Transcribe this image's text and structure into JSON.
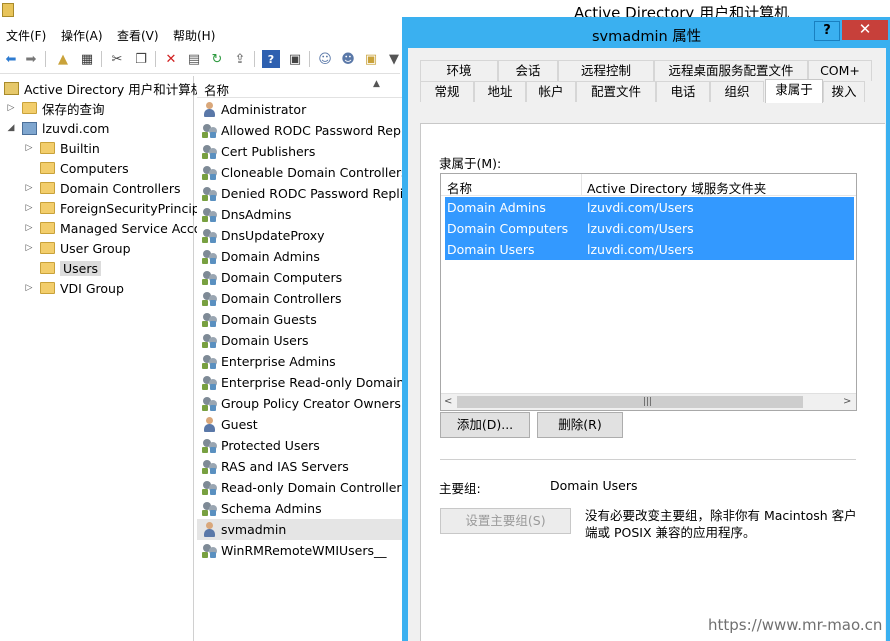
{
  "main_window": {
    "title": "Active Directory 用户和计算机",
    "menu": [
      "文件(F)",
      "操作(A)",
      "查看(V)",
      "帮助(H)"
    ],
    "toolbar_icons": [
      "back-icon",
      "forward-icon",
      "up-folder-icon",
      "show-tree-icon",
      "cut-icon",
      "copy-icon",
      "delete-icon",
      "properties-icon",
      "refresh-icon",
      "export-icon",
      "help-icon",
      "console-icon",
      "new-user-icon",
      "new-group-icon",
      "new-ou-icon",
      "filter-icon"
    ]
  },
  "tree": {
    "root": "Active Directory 用户和计算机",
    "saved_queries": "保存的查询",
    "domain": "lzuvdi.com",
    "children": [
      "Builtin",
      "Computers",
      "Domain Controllers",
      "ForeignSecurityPrincipals",
      "Managed Service Accounts",
      "User Group",
      "Users",
      "VDI Group"
    ],
    "selected": "Users"
  },
  "list": {
    "header": "名称",
    "items": [
      {
        "name": "Administrator",
        "type": "user"
      },
      {
        "name": "Allowed RODC Password Replication Group",
        "type": "group"
      },
      {
        "name": "Cert Publishers",
        "type": "group"
      },
      {
        "name": "Cloneable Domain Controllers",
        "type": "group"
      },
      {
        "name": "Denied RODC Password Replication Group",
        "type": "group"
      },
      {
        "name": "DnsAdmins",
        "type": "group"
      },
      {
        "name": "DnsUpdateProxy",
        "type": "group"
      },
      {
        "name": "Domain Admins",
        "type": "group"
      },
      {
        "name": "Domain Computers",
        "type": "group"
      },
      {
        "name": "Domain Controllers",
        "type": "group"
      },
      {
        "name": "Domain Guests",
        "type": "group"
      },
      {
        "name": "Domain Users",
        "type": "group"
      },
      {
        "name": "Enterprise Admins",
        "type": "group"
      },
      {
        "name": "Enterprise Read-only Domain Controllers",
        "type": "group"
      },
      {
        "name": "Group Policy Creator Owners",
        "type": "group"
      },
      {
        "name": "Guest",
        "type": "user"
      },
      {
        "name": "Protected Users",
        "type": "group"
      },
      {
        "name": "RAS and IAS Servers",
        "type": "group"
      },
      {
        "name": "Read-only Domain Controllers",
        "type": "group"
      },
      {
        "name": "Schema Admins",
        "type": "group"
      },
      {
        "name": "svmadmin",
        "type": "user"
      },
      {
        "name": "WinRMRemoteWMIUsers__",
        "type": "group"
      }
    ],
    "selected": "svmadmin"
  },
  "dialog": {
    "title": "svmadmin 属性",
    "help_label": "?",
    "close_label": "✕",
    "tabs_row1": [
      "环境",
      "会话",
      "远程控制",
      "远程桌面服务配置文件",
      "COM+"
    ],
    "tabs_row2": [
      "常规",
      "地址",
      "帐户",
      "配置文件",
      "电话",
      "组织",
      "隶属于",
      "拨入"
    ],
    "active_tab": "隶属于",
    "member_of_label": "隶属于(M):",
    "columns": [
      "名称",
      "Active Directory 域服务文件夹"
    ],
    "rows": [
      {
        "name": "Domain Admins",
        "folder": "lzuvdi.com/Users"
      },
      {
        "name": "Domain Computers",
        "folder": "lzuvdi.com/Users"
      },
      {
        "name": "Domain Users",
        "folder": "lzuvdi.com/Users"
      }
    ],
    "add_button": "添加(D)...",
    "remove_button": "删除(R)",
    "primary_group_label": "主要组:",
    "primary_group_value": "Domain Users",
    "set_primary_button": "设置主要组(S)",
    "note": "没有必要改变主要组，除非你有 Macintosh 客户端或 POSIX 兼容的应用程序。"
  },
  "watermark": "https://www.mr-mao.cn"
}
